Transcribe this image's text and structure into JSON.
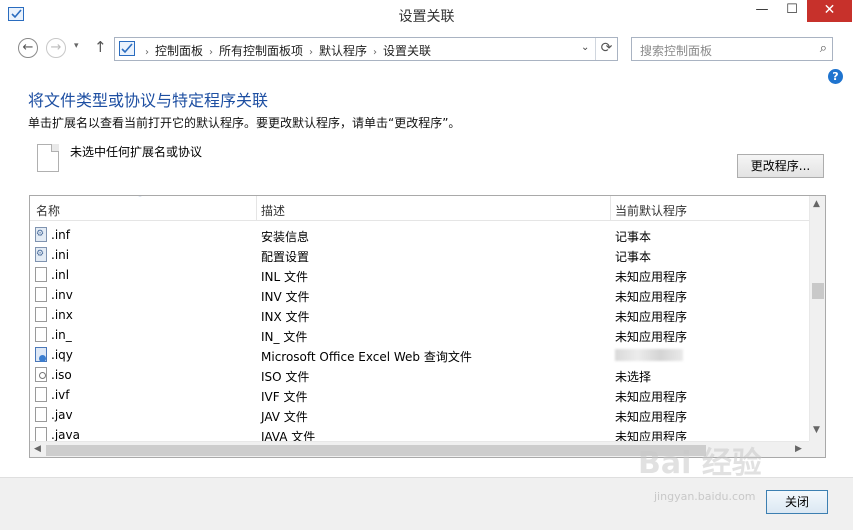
{
  "window": {
    "title": "设置关联",
    "minimize": "—",
    "maximize": "☐",
    "close": "✕"
  },
  "nav": {
    "back": "←",
    "forward": "→",
    "recent": "▾",
    "up": "↑",
    "breadcrumbs": [
      "控制面板",
      "所有控制面板项",
      "默认程序",
      "设置关联"
    ],
    "breadcrumb_sep": "›",
    "address_dropdown": "⌄",
    "refresh": "⟳",
    "search_placeholder": "搜索控制面板",
    "search_icon": "⌕"
  },
  "help": "?",
  "content": {
    "heading": "将文件类型或协议与特定程序关联",
    "subtext": "单击扩展名以查看当前打开它的默认程序。要更改默认程序，请单击“更改程序”。",
    "no_selection": "未选中任何扩展名或协议",
    "change_button": "更改程序..."
  },
  "list": {
    "columns": [
      "名称",
      "描述",
      "当前默认程序"
    ],
    "sort_indicator": "˄",
    "rows": [
      {
        "ext": ".inf",
        "desc": "安装信息",
        "prog": "记事本",
        "icon": "gear"
      },
      {
        "ext": ".ini",
        "desc": "配置设置",
        "prog": "记事本",
        "icon": "gear"
      },
      {
        "ext": ".inl",
        "desc": "INL 文件",
        "prog": "未知应用程序",
        "icon": "blank"
      },
      {
        "ext": ".inv",
        "desc": "INV 文件",
        "prog": "未知应用程序",
        "icon": "blank"
      },
      {
        "ext": ".inx",
        "desc": "INX 文件",
        "prog": "未知应用程序",
        "icon": "blank"
      },
      {
        "ext": ".in_",
        "desc": "IN_ 文件",
        "prog": "未知应用程序",
        "icon": "blank"
      },
      {
        "ext": ".iqy",
        "desc": "Microsoft Office Excel Web 查询文件",
        "prog": "",
        "icon": "web"
      },
      {
        "ext": ".iso",
        "desc": "ISO 文件",
        "prog": "未选择",
        "icon": "disc"
      },
      {
        "ext": ".ivf",
        "desc": "IVF 文件",
        "prog": "未知应用程序",
        "icon": "blank"
      },
      {
        "ext": ".jav",
        "desc": "JAV 文件",
        "prog": "未知应用程序",
        "icon": "blank"
      },
      {
        "ext": ".java",
        "desc": "JAVA 文件",
        "prog": "未知应用程序",
        "icon": "blank"
      }
    ],
    "scroll": {
      "up": "▲",
      "down": "▼",
      "left": "◀",
      "right": "▶"
    }
  },
  "footer": {
    "close_button": "关闭"
  },
  "watermark": {
    "text": "Bai 经验",
    "url": "jingyan.baidu.com"
  }
}
